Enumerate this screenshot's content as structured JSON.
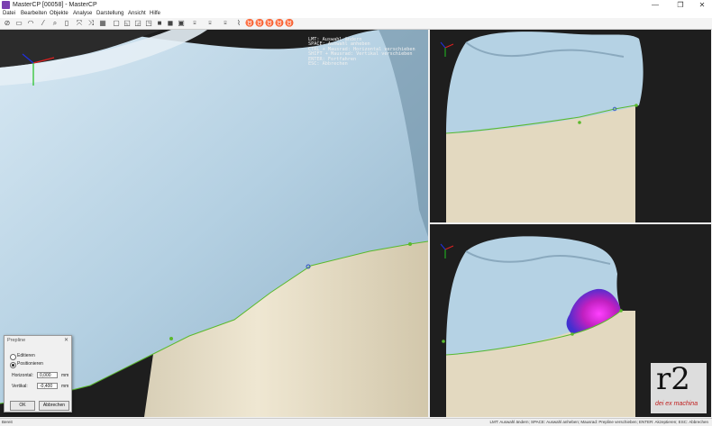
{
  "window": {
    "title": "MasterCP [00058] - MasterCP",
    "minimize": "—",
    "maximize": "❐",
    "close": "✕"
  },
  "menu": [
    "Datei",
    "Bearbeiten",
    "Objekte",
    "Analyse",
    "Darstellung",
    "Ansicht",
    "Hilfe"
  ],
  "toolbar": {
    "icons": [
      "new-icon",
      "open-icon",
      "save-icon",
      "measure-icon",
      "zoom-icon",
      "delete-icon",
      "fit-icon",
      "select-icon",
      "grid-icon",
      "box-icon",
      "crown-icon",
      "solid-icon",
      "transparent-icon",
      "layer-icon",
      "wire-icon",
      "tooth-icon"
    ]
  },
  "overlay_help": [
    "LMT: Auswahl ändern",
    "SPACE: Auswahl anheben",
    "CTRL + Mausrad: Horizontal verschieben",
    "SHIFT + Mausrad: Vertikal verschieben",
    "ENTER: Fortfahren",
    "ESC: Abbrechen"
  ],
  "dialog": {
    "title": "Prepline",
    "close": "✕",
    "options": [
      {
        "label": "Editieren",
        "selected": false
      },
      {
        "label": "Positionieren",
        "selected": true
      }
    ],
    "horizontal_label": "Horizontal:",
    "horizontal_value": "0,000",
    "vertical_label": "Vertikal:",
    "vertical_value": "-0,400",
    "unit": "mm",
    "ok_label": "OK",
    "cancel_label": "Abbrechen"
  },
  "status": {
    "left": "Bereit",
    "right": "LMT: Auswahl ändern; SPACE: Auswahl anheben; Mausrad: Prepline verschieben; ENTER: Akzeptieren; ESC: Abbrechen"
  },
  "logo": {
    "mark": "r2",
    "tagline": "dei ex machina"
  },
  "colors": {
    "background": "#1e1e1e",
    "tooth": "#b8d4e6",
    "die": "#e6dcc4",
    "prepline": "#5ab92c",
    "thickness_map": "#c030c0"
  }
}
